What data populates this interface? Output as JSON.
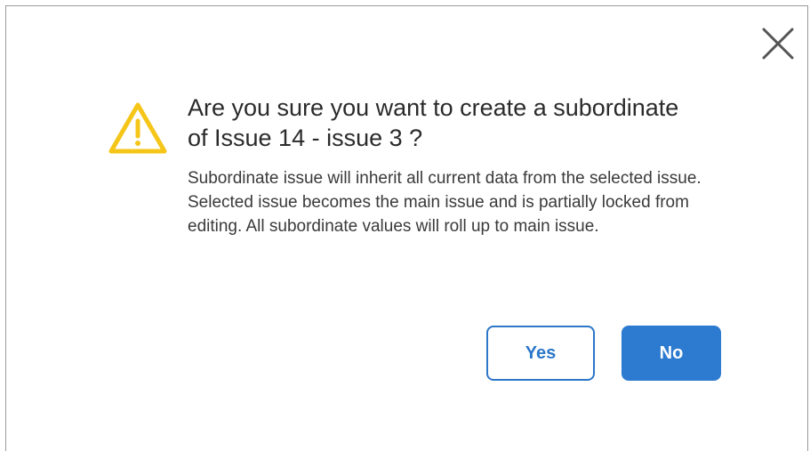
{
  "dialog": {
    "title": "Are you sure you want to create a subordinate of Issue 14 - issue 3 ?",
    "message": "Subordinate issue will inherit all current data from the selected issue. Selected issue becomes the main issue and is partially locked from editing. All subordinate values will roll up to main issue.",
    "icons": {
      "warning": "warning-triangle-icon",
      "close": "close-icon"
    },
    "buttons": {
      "yes_label": "Yes",
      "no_label": "No"
    },
    "colors": {
      "accent": "#2c7bd0",
      "warning": "#f5c518",
      "close_icon": "#555555"
    }
  }
}
